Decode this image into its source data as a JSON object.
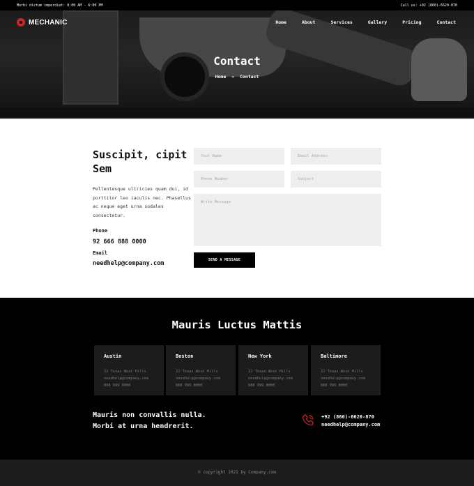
{
  "topbar": {
    "hours": "Morbi dictum imperdiet: 8:00 AM - 6:00 PM",
    "call": "Call us: +92 (860)-6620-870"
  },
  "brand": {
    "name": "MECHANIC",
    "accent": "#c62828"
  },
  "nav": [
    "Home",
    "About",
    "Services",
    "Gallery",
    "Pricing",
    "Contact"
  ],
  "hero": {
    "title": "Contact",
    "breadcrumb": {
      "home": "Home",
      "separator": "→",
      "current": "Contact"
    }
  },
  "contact": {
    "heading": "Suscipit, cipit Sem",
    "text": "Pellentesque ultricies quam dui, id porttitor leo iaculis nec. Phasellus ac neque eget urna sodales consectetur.",
    "phone_label": "Phone",
    "phone": "92 666 888 0000",
    "email_label": "Email",
    "email": "needhelp@company.com"
  },
  "form": {
    "name_placeholder": "Your Name",
    "email_placeholder": "Email Address",
    "phone_placeholder": "Phone Number",
    "subject_placeholder": "Subject",
    "message_placeholder": "Write Message",
    "submit": "SEND A MESSAGE"
  },
  "locations": {
    "title": "Mauris Luctus Mattis",
    "cards": [
      {
        "city": "Austin",
        "street": "22 Texas West Hills",
        "email": "needhelp@company.com",
        "phone": "888 999 0000"
      },
      {
        "city": "Boston",
        "street": "22 Texas West Hills",
        "email": "needhelp@company.com",
        "phone": "888 999 0000"
      },
      {
        "city": "New York",
        "street": "22 Texas West Hills",
        "email": "needhelp@company.com",
        "phone": "888 999 0000"
      },
      {
        "city": "Baltimore",
        "street": "22 Texas West Hills",
        "email": "needhelp@company.com",
        "phone": "888 999 0000"
      }
    ]
  },
  "cta": {
    "line1": "Mauris non convallis nulla.",
    "line2": "Morbi at urna hendrerit.",
    "phone": "+92 (860)-6620-870",
    "email": "needhelp@company.com",
    "icon": "phone-icon"
  },
  "footer": {
    "copyright": "© copyright 2021 by Company.com"
  }
}
